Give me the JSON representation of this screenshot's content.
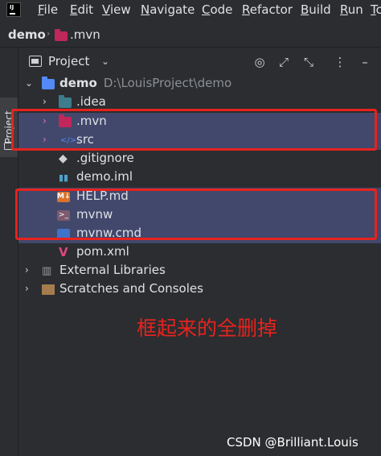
{
  "menu": [
    "File",
    "Edit",
    "View",
    "Navigate",
    "Code",
    "Refactor",
    "Build",
    "Run",
    "Tc"
  ],
  "menu_mnemonic": [
    "F",
    "E",
    "V",
    "N",
    "C",
    "R",
    "B",
    "R",
    "T"
  ],
  "breadcrumb": {
    "root": "demo",
    "current": ".mvn"
  },
  "stripe_tab": "Project",
  "panel": {
    "title": "Project"
  },
  "tree": [
    {
      "label": "demo",
      "path": "D:\\LouisProject\\demo",
      "icon": "module-folder-icon"
    },
    {
      "label": ".idea",
      "icon": "folder-icon"
    },
    {
      "label": ".mvn",
      "icon": "folder-icon"
    },
    {
      "label": "src",
      "icon": "source-folder-icon"
    },
    {
      "label": ".gitignore",
      "icon": "gitignore-file-icon"
    },
    {
      "label": "demo.iml",
      "icon": "iml-file-icon"
    },
    {
      "label": "HELP.md",
      "icon": "markdown-file-icon",
      "icon_text": "M↓"
    },
    {
      "label": "mvnw",
      "icon": "shell-script-icon"
    },
    {
      "label": "mvnw.cmd",
      "icon": "cmd-file-icon"
    },
    {
      "label": "pom.xml",
      "icon": "maven-file-icon"
    },
    {
      "label": "External Libraries",
      "icon": "libraries-icon"
    },
    {
      "label": "Scratches and Consoles",
      "icon": "scratches-icon"
    }
  ],
  "annotation": "框起来的全删掉",
  "watermark": "CSDN @Brilliant.Louis",
  "colors": {
    "background": "#2b2d30",
    "selection": "#41486c",
    "annotation_red": "#e6231e",
    "text": "#dfe1e5"
  }
}
